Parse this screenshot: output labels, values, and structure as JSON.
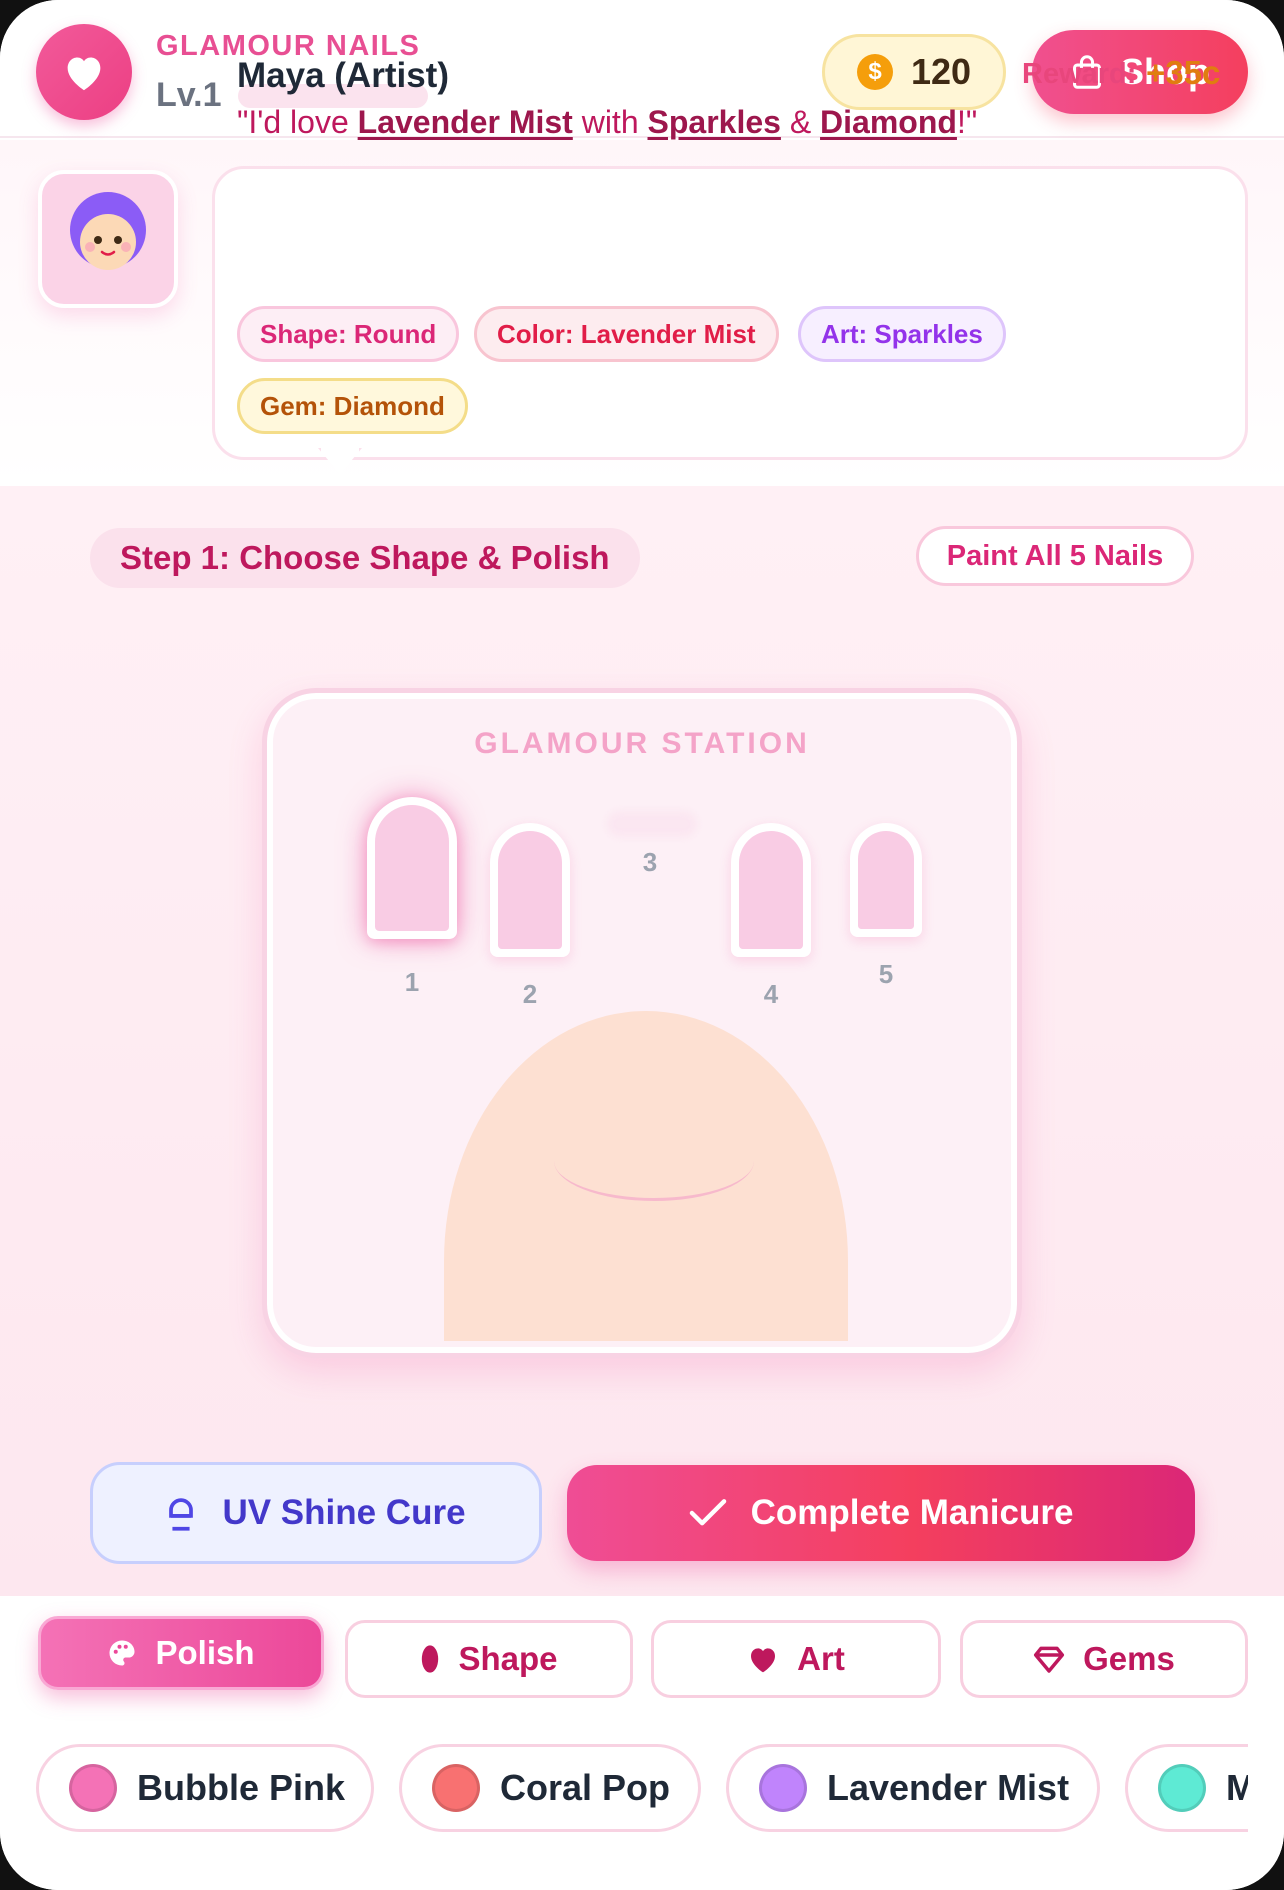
{
  "header": {
    "brand": "GLAMOUR NAILS",
    "level": "Lv.1",
    "xp_progress": 0.0,
    "coins": "120",
    "shop_label": "Shop"
  },
  "client": {
    "name": "Maya (Artist)",
    "reward_label": "Reward:",
    "reward_value": "+35c",
    "quote": {
      "open": "\"I'd love ",
      "color": "Lavender Mist",
      "with": " with ",
      "art": "Sparkles",
      "amp": " & ",
      "gem": "Diamond",
      "close": "!\""
    },
    "tags": {
      "shape": "Shape: Round",
      "color": "Color: Lavender Mist",
      "art": "Art: Sparkles",
      "gem": "Gem: Diamond"
    }
  },
  "step_label": "Step 1: Choose Shape & Polish",
  "paint_all_label": "Paint All 5 Nails",
  "station": {
    "title": "GLAMOUR STATION",
    "nails": [
      "1",
      "2",
      "3",
      "4",
      "5"
    ]
  },
  "actions": {
    "uv_label": "UV Shine Cure",
    "complete_label": "Complete Manicure"
  },
  "tabs": {
    "polish": "Polish",
    "shape": "Shape",
    "art": "Art",
    "gems": "Gems"
  },
  "polishes": [
    {
      "name": "Bubble Pink",
      "color": "#f472b6"
    },
    {
      "name": "Coral Pop",
      "color": "#f87171"
    },
    {
      "name": "Lavender Mist",
      "color": "#c084fc"
    },
    {
      "name": "M",
      "color": "#5eead4"
    }
  ],
  "colors": {
    "accent": "#ec4899",
    "coin": "#f59e0b",
    "nail_base": "#f9cce4",
    "skin": "#fde0d2"
  }
}
